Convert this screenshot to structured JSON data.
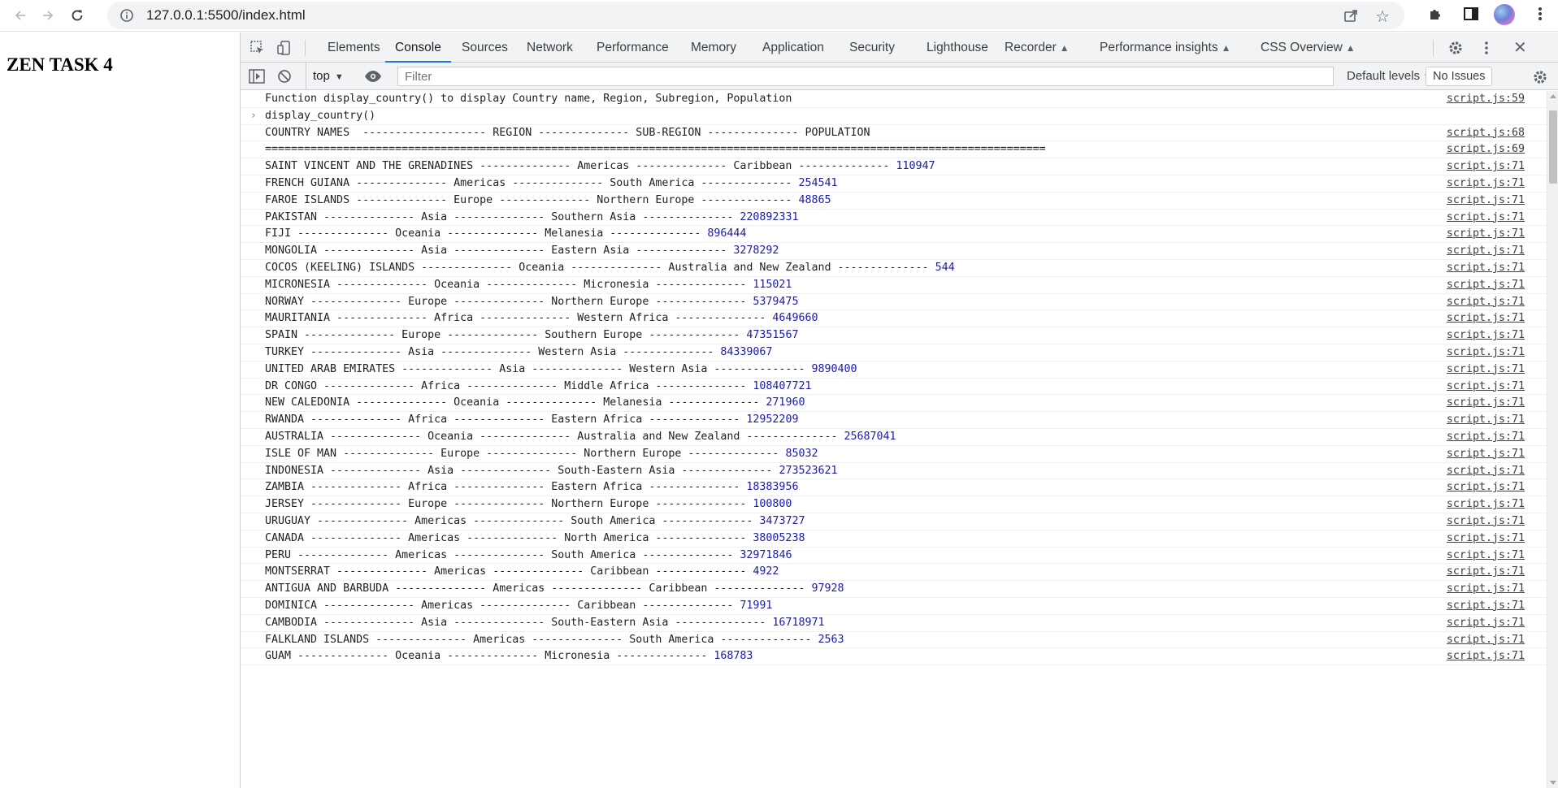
{
  "browser": {
    "url": "127.0.0.1:5500/index.html"
  },
  "page": {
    "heading": "ZEN TASK 4"
  },
  "devtools": {
    "tabs": [
      {
        "label": "Elements"
      },
      {
        "label": "Console",
        "active": true
      },
      {
        "label": "Sources"
      },
      {
        "label": "Network"
      },
      {
        "label": "Performance"
      },
      {
        "label": "Memory"
      },
      {
        "label": "Application"
      },
      {
        "label": "Security"
      },
      {
        "label": "Lighthouse"
      },
      {
        "label": "Recorder",
        "experimental": true
      },
      {
        "label": "Performance insights",
        "experimental": true
      },
      {
        "label": "CSS Overview",
        "experimental": true
      }
    ],
    "console": {
      "context": "top",
      "filter_placeholder": "Filter",
      "levels": "Default levels",
      "issues": "No Issues",
      "messages": [
        {
          "text": "Function display_country() to display Country name, Region, Subregion, Population",
          "source": "script.js:59"
        },
        {
          "text": "display_country()",
          "source": "",
          "input": true
        },
        {
          "text": "COUNTRY NAMES  ------------------- REGION -------------- SUB-REGION -------------- POPULATION",
          "source": "script.js:68"
        },
        {
          "text": "========================================================================================================================",
          "source": "script.js:69"
        },
        {
          "text": "SAINT VINCENT AND THE GRENADINES -------------- Americas -------------- Caribbean -------------- ",
          "num": "110947",
          "source": "script.js:71"
        },
        {
          "text": "FRENCH GUIANA -------------- Americas -------------- South America -------------- ",
          "num": "254541",
          "source": "script.js:71"
        },
        {
          "text": "FAROE ISLANDS -------------- Europe -------------- Northern Europe -------------- ",
          "num": "48865",
          "source": "script.js:71"
        },
        {
          "text": "PAKISTAN -------------- Asia -------------- Southern Asia -------------- ",
          "num": "220892331",
          "source": "script.js:71"
        },
        {
          "text": "FIJI -------------- Oceania -------------- Melanesia -------------- ",
          "num": "896444",
          "source": "script.js:71"
        },
        {
          "text": "MONGOLIA -------------- Asia -------------- Eastern Asia -------------- ",
          "num": "3278292",
          "source": "script.js:71"
        },
        {
          "text": "COCOS (KEELING) ISLANDS -------------- Oceania -------------- Australia and New Zealand -------------- ",
          "num": "544",
          "source": "script.js:71"
        },
        {
          "text": "MICRONESIA -------------- Oceania -------------- Micronesia -------------- ",
          "num": "115021",
          "source": "script.js:71"
        },
        {
          "text": "NORWAY -------------- Europe -------------- Northern Europe -------------- ",
          "num": "5379475",
          "source": "script.js:71"
        },
        {
          "text": "MAURITANIA -------------- Africa -------------- Western Africa -------------- ",
          "num": "4649660",
          "source": "script.js:71"
        },
        {
          "text": "SPAIN -------------- Europe -------------- Southern Europe -------------- ",
          "num": "47351567",
          "source": "script.js:71"
        },
        {
          "text": "TURKEY -------------- Asia -------------- Western Asia -------------- ",
          "num": "84339067",
          "source": "script.js:71"
        },
        {
          "text": "UNITED ARAB EMIRATES -------------- Asia -------------- Western Asia -------------- ",
          "num": "9890400",
          "source": "script.js:71"
        },
        {
          "text": "DR CONGO -------------- Africa -------------- Middle Africa -------------- ",
          "num": "108407721",
          "source": "script.js:71"
        },
        {
          "text": "NEW CALEDONIA -------------- Oceania -------------- Melanesia -------------- ",
          "num": "271960",
          "source": "script.js:71"
        },
        {
          "text": "RWANDA -------------- Africa -------------- Eastern Africa -------------- ",
          "num": "12952209",
          "source": "script.js:71"
        },
        {
          "text": "AUSTRALIA -------------- Oceania -------------- Australia and New Zealand -------------- ",
          "num": "25687041",
          "source": "script.js:71"
        },
        {
          "text": "ISLE OF MAN -------------- Europe -------------- Northern Europe -------------- ",
          "num": "85032",
          "source": "script.js:71"
        },
        {
          "text": "INDONESIA -------------- Asia -------------- South-Eastern Asia -------------- ",
          "num": "273523621",
          "source": "script.js:71"
        },
        {
          "text": "ZAMBIA -------------- Africa -------------- Eastern Africa -------------- ",
          "num": "18383956",
          "source": "script.js:71"
        },
        {
          "text": "JERSEY -------------- Europe -------------- Northern Europe -------------- ",
          "num": "100800",
          "source": "script.js:71"
        },
        {
          "text": "URUGUAY -------------- Americas -------------- South America -------------- ",
          "num": "3473727",
          "source": "script.js:71"
        },
        {
          "text": "CANADA -------------- Americas -------------- North America -------------- ",
          "num": "38005238",
          "source": "script.js:71"
        },
        {
          "text": "PERU -------------- Americas -------------- South America -------------- ",
          "num": "32971846",
          "source": "script.js:71"
        },
        {
          "text": "MONTSERRAT -------------- Americas -------------- Caribbean -------------- ",
          "num": "4922",
          "source": "script.js:71"
        },
        {
          "text": "ANTIGUA AND BARBUDA -------------- Americas -------------- Caribbean -------------- ",
          "num": "97928",
          "source": "script.js:71"
        },
        {
          "text": "DOMINICA -------------- Americas -------------- Caribbean -------------- ",
          "num": "71991",
          "source": "script.js:71"
        },
        {
          "text": "CAMBODIA -------------- Asia -------------- South-Eastern Asia -------------- ",
          "num": "16718971",
          "source": "script.js:71"
        },
        {
          "text": "FALKLAND ISLANDS -------------- Americas -------------- South America -------------- ",
          "num": "2563",
          "source": "script.js:71"
        },
        {
          "text": "GUAM -------------- Oceania -------------- Micronesia -------------- ",
          "num": "168783",
          "source": "script.js:71"
        }
      ]
    }
  }
}
